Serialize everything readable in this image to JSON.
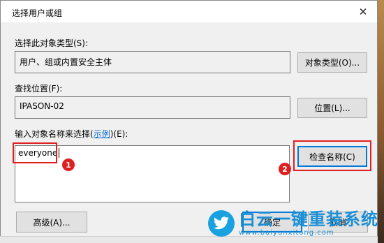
{
  "dialog": {
    "title": "选择用户或组",
    "close_icon": "close-icon"
  },
  "object_type": {
    "label": "选择此对象类型(S):",
    "value": "用户、组或内置安全主体",
    "button": "对象类型(O)..."
  },
  "location": {
    "label": "查找位置(F):",
    "value": "IPASON-02",
    "button": "位置(L)..."
  },
  "names": {
    "label_prefix": "输入对象名称来选择(",
    "label_link": "示例",
    "label_suffix": ")(E):",
    "entered_value": "everyone",
    "check_button": "检查名称(C)"
  },
  "footer": {
    "advanced_button": "高级(A)...",
    "ok_button": "确定",
    "cancel_button": "取消"
  },
  "annotations": {
    "step1": "1",
    "step2": "2",
    "color": "#e02020"
  },
  "watermark": {
    "text": "白云一键重装系统",
    "url": "www.baiyunxitong.com",
    "logo_icon": "twitter-bird-icon",
    "color": "#1a8fd6"
  }
}
